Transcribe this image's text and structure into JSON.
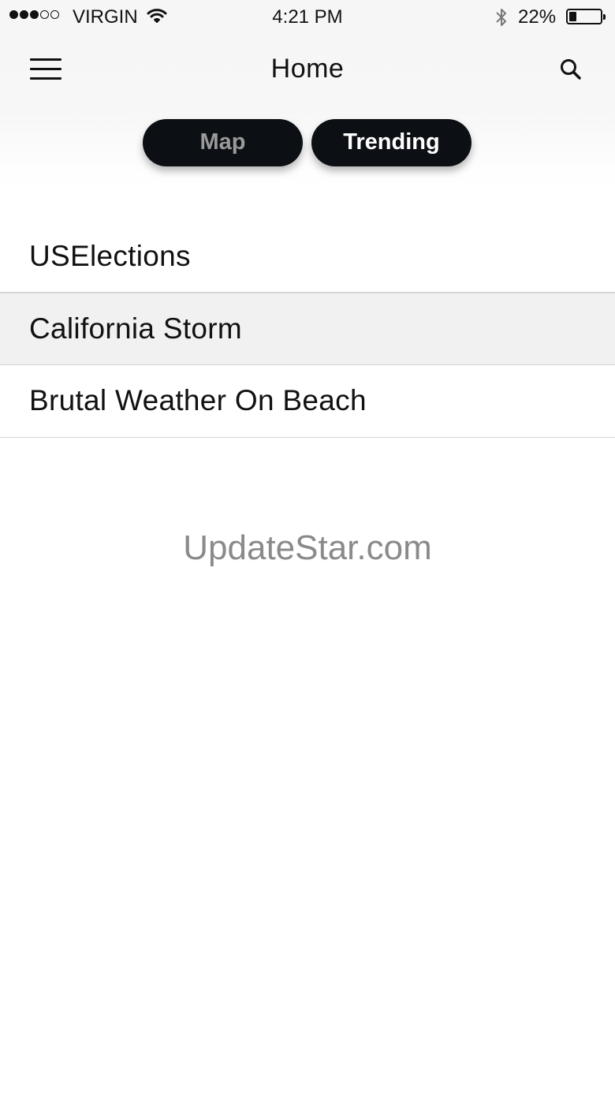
{
  "status_bar": {
    "carrier": "VIRGIN",
    "signal_bars_filled": 3,
    "signal_bars_total": 5,
    "time": "4:21 PM",
    "battery_percent": "22%",
    "icons": [
      "wifi-icon",
      "bluetooth-icon",
      "battery-icon"
    ]
  },
  "nav": {
    "title": "Home",
    "menu_icon": "hamburger-menu-icon",
    "search_icon": "search-icon"
  },
  "segments": {
    "map_label": "Map",
    "trending_label": "Trending",
    "selected": "Trending"
  },
  "trending_list": [
    {
      "label": "USElections"
    },
    {
      "label": "California Storm",
      "highlighted": true
    },
    {
      "label": "Brutal Weather On Beach"
    }
  ],
  "watermark": "UpdateStar.com",
  "colors": {
    "pill_background": "#0c1014",
    "pill_inactive_text": "#9a9a9a",
    "highlight_row": "#f1f1f1"
  }
}
